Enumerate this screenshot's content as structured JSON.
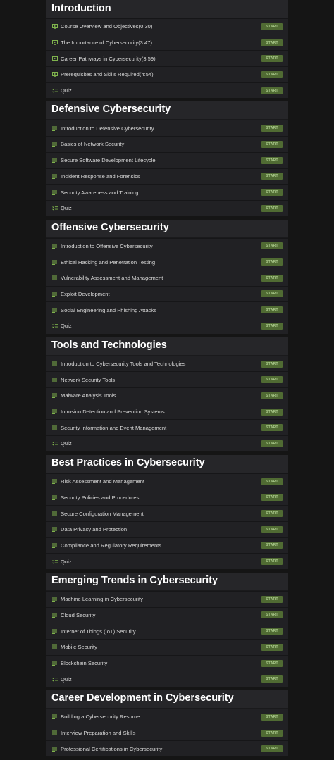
{
  "colors": {
    "page_bg": "#151515",
    "section_bg": "#212124",
    "accent": "#7fb34d",
    "start_bg": "#506b33",
    "start_text": "#a9c88a"
  },
  "start_label": "START",
  "sections": [
    {
      "title": "Introduction",
      "lessons": [
        {
          "label": "Course Overview and Objectives(0:30)",
          "icon": "video-icon"
        },
        {
          "label": "The Importance of Cybersecurity(3:47)",
          "icon": "video-icon"
        },
        {
          "label": "Career Pathways in Cybersecurity(3:59)",
          "icon": "video-icon"
        },
        {
          "label": "Prerequisites and Skills Required(4:54)",
          "icon": "video-icon"
        },
        {
          "label": "Quiz",
          "icon": "quiz-icon"
        }
      ]
    },
    {
      "title": "Defensive Cybersecurity",
      "lessons": [
        {
          "label": "Introduction to Defensive Cybersecurity",
          "icon": "text-icon"
        },
        {
          "label": "Basics of Network Security",
          "icon": "text-icon"
        },
        {
          "label": "Secure Software Development Lifecycle",
          "icon": "text-icon"
        },
        {
          "label": "Incident Response and Forensics",
          "icon": "text-icon"
        },
        {
          "label": "Security Awareness and Training",
          "icon": "text-icon"
        },
        {
          "label": "Quiz",
          "icon": "quiz-icon"
        }
      ]
    },
    {
      "title": "Offensive Cybersecurity",
      "lessons": [
        {
          "label": "Introduction to Offensive Cybersecurity",
          "icon": "text-icon"
        },
        {
          "label": "Ethical Hacking and Penetration Testing",
          "icon": "text-icon"
        },
        {
          "label": "Vulnerability Assessment and Management",
          "icon": "text-icon"
        },
        {
          "label": "Exploit Development",
          "icon": "text-icon"
        },
        {
          "label": "Social Engineering and Phishing Attacks",
          "icon": "text-icon"
        },
        {
          "label": "Quiz",
          "icon": "quiz-icon"
        }
      ]
    },
    {
      "title": "Tools and Technologies",
      "lessons": [
        {
          "label": "Introduction to Cybersecurity Tools and Technologies",
          "icon": "text-icon"
        },
        {
          "label": "Network Security Tools",
          "icon": "text-icon"
        },
        {
          "label": "Malware Analysis Tools",
          "icon": "text-icon"
        },
        {
          "label": "Intrusion Detection and Prevention Systems",
          "icon": "text-icon"
        },
        {
          "label": "Security Information and Event Management",
          "icon": "text-icon"
        },
        {
          "label": "Quiz",
          "icon": "quiz-icon"
        }
      ]
    },
    {
      "title": "Best Practices in Cybersecurity",
      "lessons": [
        {
          "label": "Risk Assessment and Management",
          "icon": "text-icon"
        },
        {
          "label": "Security Policies and Procedures",
          "icon": "text-icon"
        },
        {
          "label": "Secure Configuration Management",
          "icon": "text-icon"
        },
        {
          "label": "Data Privacy and Protection",
          "icon": "text-icon"
        },
        {
          "label": "Compliance and Regulatory Requirements",
          "icon": "text-icon"
        },
        {
          "label": "Quiz",
          "icon": "quiz-icon"
        }
      ]
    },
    {
      "title": "Emerging Trends in Cybersecurity",
      "lessons": [
        {
          "label": "Machine Learning in Cybersecurity",
          "icon": "text-icon"
        },
        {
          "label": "Cloud Security",
          "icon": "text-icon"
        },
        {
          "label": "Internet of Things (IoT) Security",
          "icon": "text-icon"
        },
        {
          "label": "Mobile Security",
          "icon": "text-icon"
        },
        {
          "label": "Blockchain Security",
          "icon": "text-icon"
        },
        {
          "label": "Quiz",
          "icon": "quiz-icon"
        }
      ]
    },
    {
      "title": "Career Development in Cybersecurity",
      "lessons": [
        {
          "label": "Building a Cybersecurity Resume",
          "icon": "text-icon"
        },
        {
          "label": "Interview Preparation and Skills",
          "icon": "text-icon"
        },
        {
          "label": "Professional Certifications in Cybersecurity",
          "icon": "text-icon"
        }
      ]
    }
  ]
}
